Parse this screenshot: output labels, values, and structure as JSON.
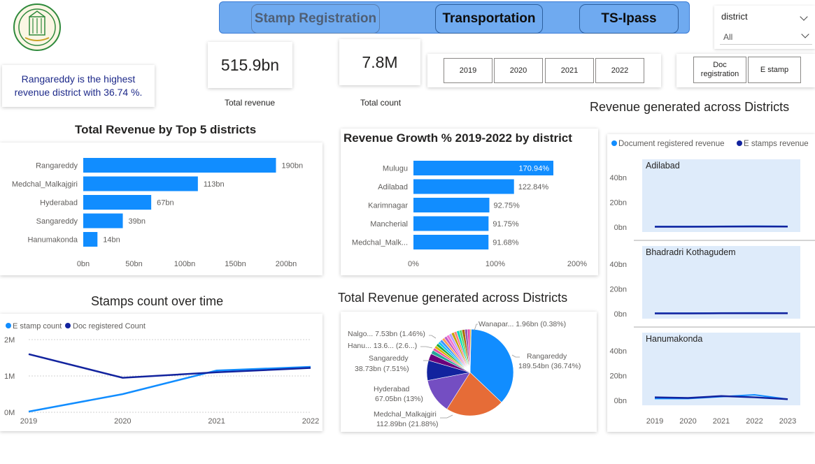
{
  "nav": {
    "stamp_label": "Stamp Registration",
    "transport_label": "Transportation",
    "tsipass_label": "TS-Ipass"
  },
  "district_slicer": {
    "title": "district",
    "value": "All"
  },
  "kpis": {
    "total_revenue": "515.9bn",
    "total_revenue_label": "Total revenue",
    "total_count": "7.8M",
    "total_count_label": "Total count"
  },
  "years": [
    "2019",
    "2020",
    "2021",
    "2022"
  ],
  "type_slicer": [
    "Doc registration",
    "E stamp"
  ],
  "insight": "Rangareddy is the highest revenue district with 36.74 %.",
  "titles": {
    "top5": "Total Revenue by  Top 5 districts",
    "growth": "Revenue Growth % 2019-2022 by district",
    "stamps": "Stamps count over time",
    "pie": "Total Revenue generated across Districts",
    "district_lines": "Revenue generated across Districts"
  },
  "colors": {
    "accent": "#118dff",
    "dark": "#12239e",
    "orange": "#e66c37",
    "purple": "#6b007b",
    "violet": "#744ec2",
    "nav": "#6faaf0"
  },
  "chart_data": [
    {
      "type": "bar",
      "title": "Total Revenue by  Top 5 districts",
      "categories": [
        "Rangareddy",
        "Medchal_Malkajgiri",
        "Hyderabad",
        "Sangareddy",
        "Hanumakonda"
      ],
      "values": [
        190,
        113,
        67,
        39,
        14
      ],
      "value_labels": [
        "190bn",
        "113bn",
        "67bn",
        "39bn",
        "14bn"
      ],
      "xticks": [
        "0bn",
        "50bn",
        "100bn",
        "150bn",
        "200bn"
      ],
      "xlim": [
        0,
        200
      ]
    },
    {
      "type": "bar",
      "title": "Revenue Growth % 2019-2022 by district",
      "categories": [
        "Mulugu",
        "Adilabad",
        "Karimnagar",
        "Mancherial",
        "Medchal_Malk..."
      ],
      "values": [
        170.94,
        122.84,
        92.75,
        91.75,
        91.68
      ],
      "value_labels": [
        "170.94%",
        "122.84%",
        "92.75%",
        "91.75%",
        "91.68%"
      ],
      "xticks": [
        "0%",
        "100%",
        "200%"
      ],
      "xlim": [
        0,
        200
      ]
    },
    {
      "type": "line",
      "title": "Stamps count over time",
      "x": [
        "2019",
        "2020",
        "2021",
        "2022"
      ],
      "series": [
        {
          "name": "E stamp count",
          "values": [
            0.02,
            0.5,
            1.15,
            1.25
          ]
        },
        {
          "name": "Doc registered Count",
          "values": [
            1.6,
            0.95,
            1.1,
            1.22
          ]
        }
      ],
      "yticks": [
        "0M",
        "1M",
        "2M"
      ],
      "ylim": [
        0,
        2
      ]
    },
    {
      "type": "pie",
      "title": "Total Revenue generated across Districts",
      "slices": [
        {
          "label": "Rangareddy",
          "value": 189.54,
          "text": "189.54bn (36.74%)",
          "pct": 36.74
        },
        {
          "label": "Medchal_Malkajgiri",
          "value": 112.89,
          "text": "112.89bn (21.88%)",
          "pct": 21.88
        },
        {
          "label": "Hyderabad",
          "value": 67.05,
          "text": "67.05bn (13%)",
          "pct": 13.0
        },
        {
          "label": "Sangareddy",
          "value": 38.73,
          "text": "38.73bn (7.51%)",
          "pct": 7.51
        },
        {
          "label": "Hanu...",
          "value": 13.6,
          "text": "13.6... (2.6...)",
          "pct": 2.64
        },
        {
          "label": "Nalgo...",
          "value": 7.53,
          "text": "7.53bn (1.46%)",
          "pct": 1.46
        },
        {
          "label": "Wanapar...",
          "value": 1.96,
          "text": "1.96bn (0.38%)",
          "pct": 0.38
        }
      ],
      "other_pct": 16.43
    },
    {
      "type": "line",
      "title": "Revenue generated across Districts",
      "legend": [
        "Document registered revenue",
        "E stamps revenue"
      ],
      "x": [
        "2019",
        "2020",
        "2021",
        "2022",
        "2023"
      ],
      "yticks": [
        "0bn",
        "20bn",
        "40bn"
      ],
      "ylim": [
        0,
        50
      ],
      "panels": [
        {
          "name": "Adilabad",
          "doc": [
            0.5,
            0.5,
            0.6,
            0.8,
            0.6
          ],
          "estamp": [
            0.3,
            0.3,
            0.4,
            0.5,
            0.4
          ]
        },
        {
          "name": "Bhadradri Kothagudem",
          "doc": [
            0.5,
            0.5,
            0.6,
            0.7,
            0.6
          ],
          "estamp": [
            0.3,
            0.3,
            0.4,
            0.4,
            0.4
          ]
        },
        {
          "name": "Hanumakonda",
          "doc": [
            1.5,
            1.5,
            3.0,
            4.5,
            1.0
          ],
          "estamp": [
            2.5,
            2.0,
            3.5,
            2.5,
            1.0
          ]
        }
      ]
    }
  ]
}
